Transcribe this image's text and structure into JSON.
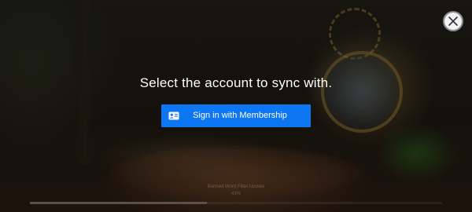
{
  "dialog": {
    "title": "Select the account to sync with.",
    "signin_button_label": "Sign in with Membership",
    "signin_icon": "id-card-icon",
    "close_icon": "close-icon"
  },
  "background_status": {
    "update_label": "Banned Word Filter Update",
    "update_percent_text": "43%",
    "progress_fraction": 0.43
  },
  "colors": {
    "button_blue": "#0d76f2",
    "text_white": "#ffffff"
  }
}
